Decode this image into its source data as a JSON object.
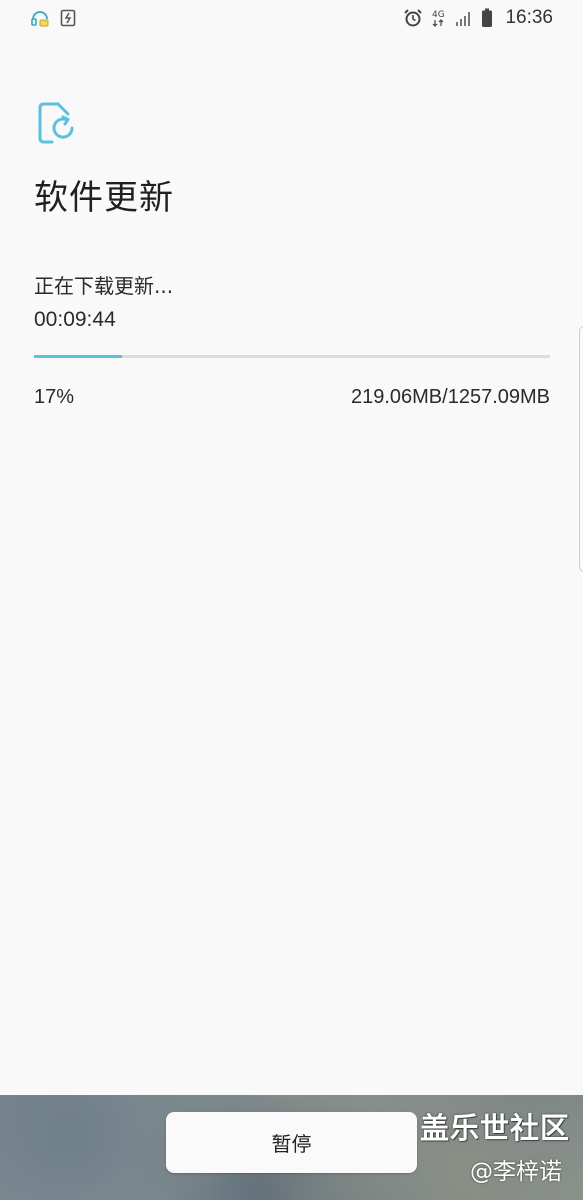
{
  "status_bar": {
    "time": "16:36",
    "network": "4G",
    "left_icons": [
      "headset-notification-icon",
      "file-transfer-icon"
    ],
    "right_icons": [
      "alarm-icon",
      "network-4g-icon",
      "signal-icon",
      "battery-icon"
    ]
  },
  "header": {
    "icon": "software-update-icon",
    "title": "软件更新"
  },
  "download": {
    "status": "正在下载更新...",
    "time_remaining": "00:09:44",
    "progress_fraction": 0.17,
    "percent_label": "17%",
    "size_label": "219.06MB/1257.09MB"
  },
  "bottom": {
    "pause_label": "暂停"
  },
  "watermark": {
    "title": "盖乐世社区",
    "author": "@李梓诺"
  },
  "colors": {
    "accent": "#5cc1dd",
    "background": "#f9f9f9",
    "track": "#dcdcdc"
  }
}
